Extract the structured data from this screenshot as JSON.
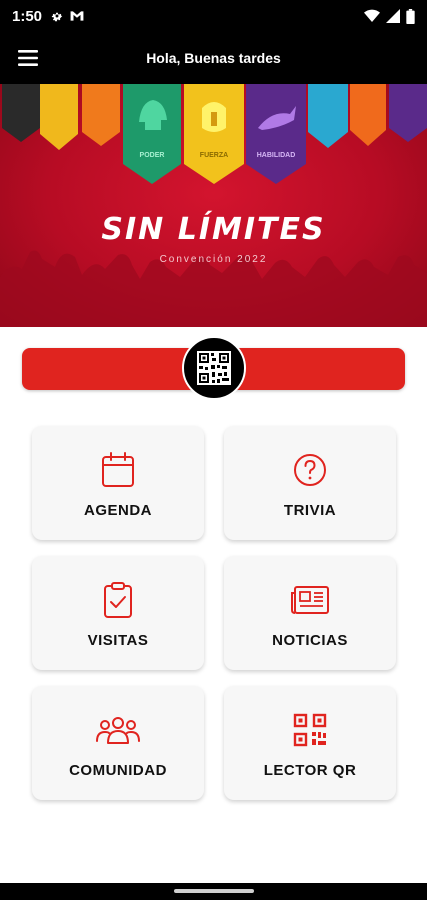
{
  "status_bar": {
    "time": "1:50",
    "icons_left": [
      "gear-icon",
      "gmail-icon"
    ],
    "icons_right": [
      "wifi-icon",
      "signal-icon",
      "battery-icon"
    ]
  },
  "app_bar": {
    "title": "Hola, Buenas tardes",
    "menu_icon": "hamburger-menu-icon"
  },
  "banner": {
    "title": "SIN LÍMITES",
    "subtitle": "Convención 2022",
    "pennant_labels": [
      "PODER",
      "FUERZA",
      "HABILIDAD"
    ],
    "colors": {
      "background": "#c0102a",
      "pennants": [
        "#2a2a2a",
        "#f0b81c",
        "#f07a1c",
        "#1e9a6a",
        "#f2c21c",
        "#5a2a8a",
        "#2aa8d0",
        "#f06a1c",
        "#5a2a8a"
      ]
    }
  },
  "qr_bar": {
    "icon": "qr-code-icon",
    "color": "#e0241f"
  },
  "menu": [
    {
      "label": "AGENDA",
      "icon": "calendar-icon"
    },
    {
      "label": "TRIVIA",
      "icon": "question-circle-icon"
    },
    {
      "label": "VISITAS",
      "icon": "clipboard-check-icon"
    },
    {
      "label": "NOTICIAS",
      "icon": "newspaper-icon"
    },
    {
      "label": "COMUNIDAD",
      "icon": "community-group-icon"
    },
    {
      "label": "LECTOR QR",
      "icon": "qr-scanner-icon"
    }
  ],
  "accent_color": "#e0241f"
}
